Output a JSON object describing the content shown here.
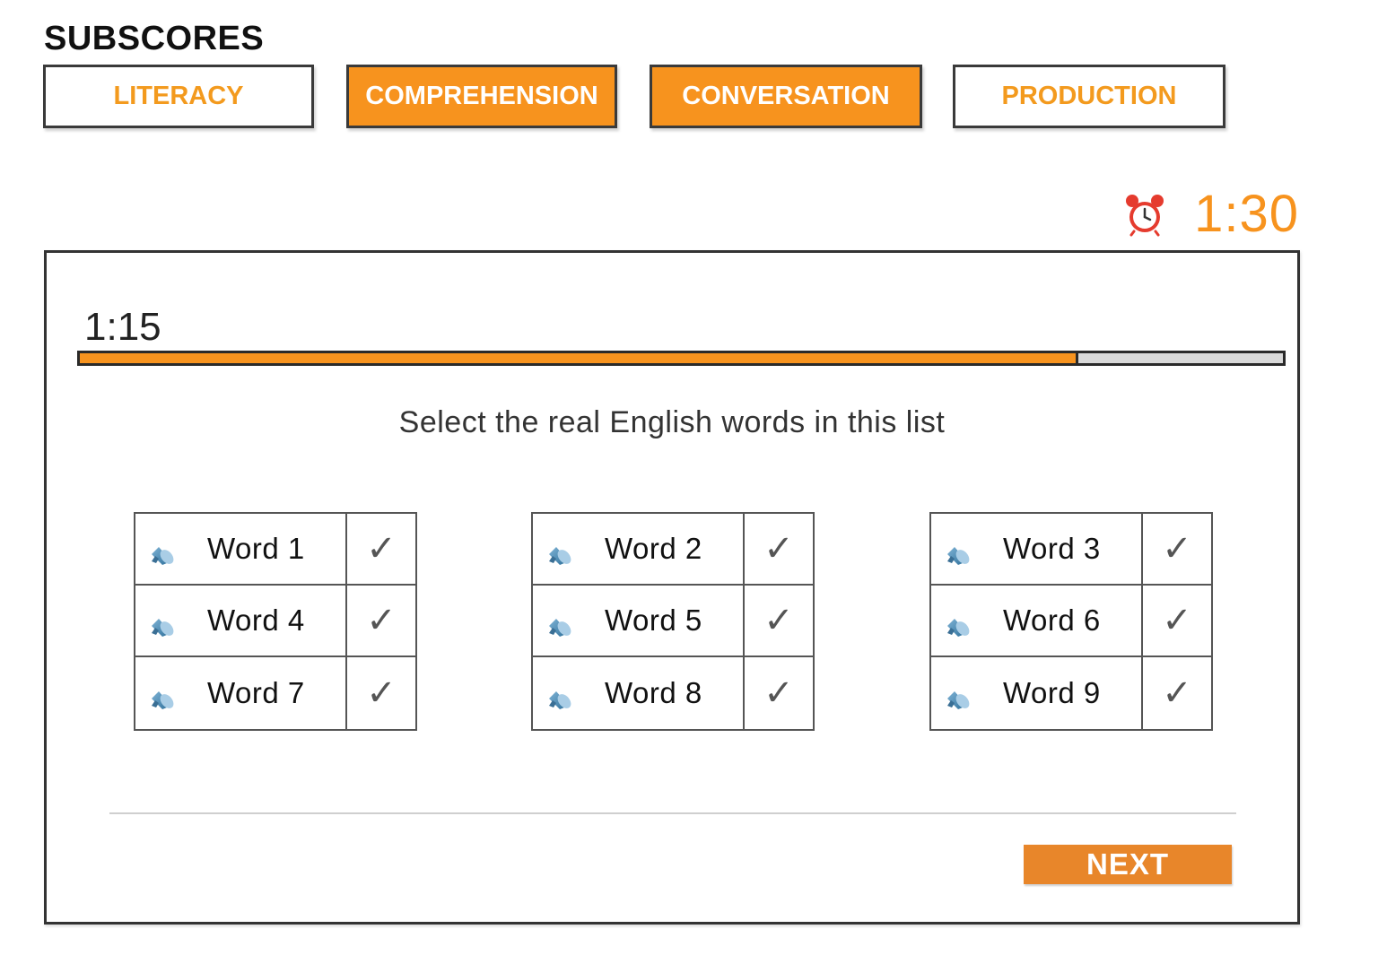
{
  "header": {
    "title": "SUBSCORES",
    "tabs": [
      {
        "label": "LITERACY",
        "state": "outline"
      },
      {
        "label": "COMPREHENSION",
        "state": "filled"
      },
      {
        "label": "CONVERSATION",
        "state": "filled"
      },
      {
        "label": "PRODUCTION",
        "state": "outline"
      }
    ]
  },
  "global_timer": {
    "icon": "alarm-clock-icon",
    "value": "1:30"
  },
  "question": {
    "timer": "1:15",
    "progress_fraction": 0.83,
    "instruction": "Select the real English words in this list",
    "groups": [
      {
        "words": [
          "Word 1",
          "Word 4",
          "Word 7"
        ]
      },
      {
        "words": [
          "Word 2",
          "Word 5",
          "Word 8"
        ]
      },
      {
        "words": [
          "Word 3",
          "Word 6",
          "Word 9"
        ]
      }
    ],
    "check_glyph": "✓",
    "speaker_icon": "speaker-icon"
  },
  "footer": {
    "next_label": "NEXT"
  },
  "colors": {
    "accent": "#f7931e",
    "next_button": "#e8862a",
    "progress_track": "#d9d9d9"
  }
}
